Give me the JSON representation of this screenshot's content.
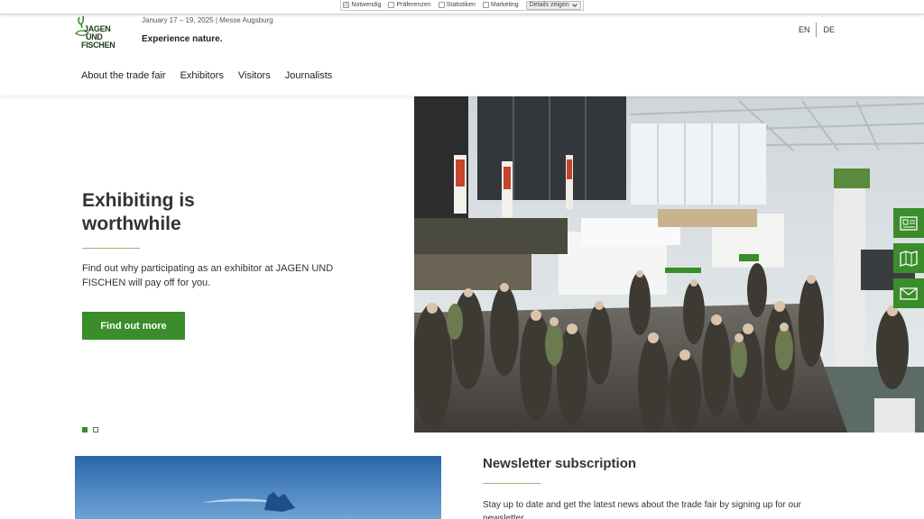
{
  "cookie_bar": {
    "options": [
      {
        "label": "Notwendig",
        "checked": true
      },
      {
        "label": "Präferenzen",
        "checked": false
      },
      {
        "label": "Statistiken",
        "checked": false
      },
      {
        "label": "Marketing",
        "checked": false
      }
    ],
    "details_label": "Details zeigen"
  },
  "header": {
    "logo": {
      "line1": "JAGEN",
      "line2": "UND",
      "line3": "FISCHEN"
    },
    "event_date": "January 17 – 19, 2025 | Messe Augsburg",
    "claim": "Experience nature.",
    "languages": [
      "EN",
      "DE"
    ],
    "nav": [
      "About the trade fair",
      "Exhibitors",
      "Visitors",
      "Journalists"
    ]
  },
  "hero": {
    "title_line1": "Exhibiting is",
    "title_line2": "worthwhile",
    "description": "Find out why participating as an exhibitor at JAGEN UND FISCHEN will pay off for you.",
    "button_label": "Find out more",
    "slides": [
      {
        "active": true
      },
      {
        "active": false
      }
    ]
  },
  "side_tools": [
    "newspaper-icon",
    "map-icon",
    "mail-icon"
  ],
  "newsletter": {
    "title": "Newsletter subscription",
    "text": "Stay up to date and get the latest news about the trade fair by signing up for our newsletter."
  },
  "colors": {
    "accent": "#3b8c2a",
    "rule": "#9ab27a",
    "text": "#333333"
  }
}
